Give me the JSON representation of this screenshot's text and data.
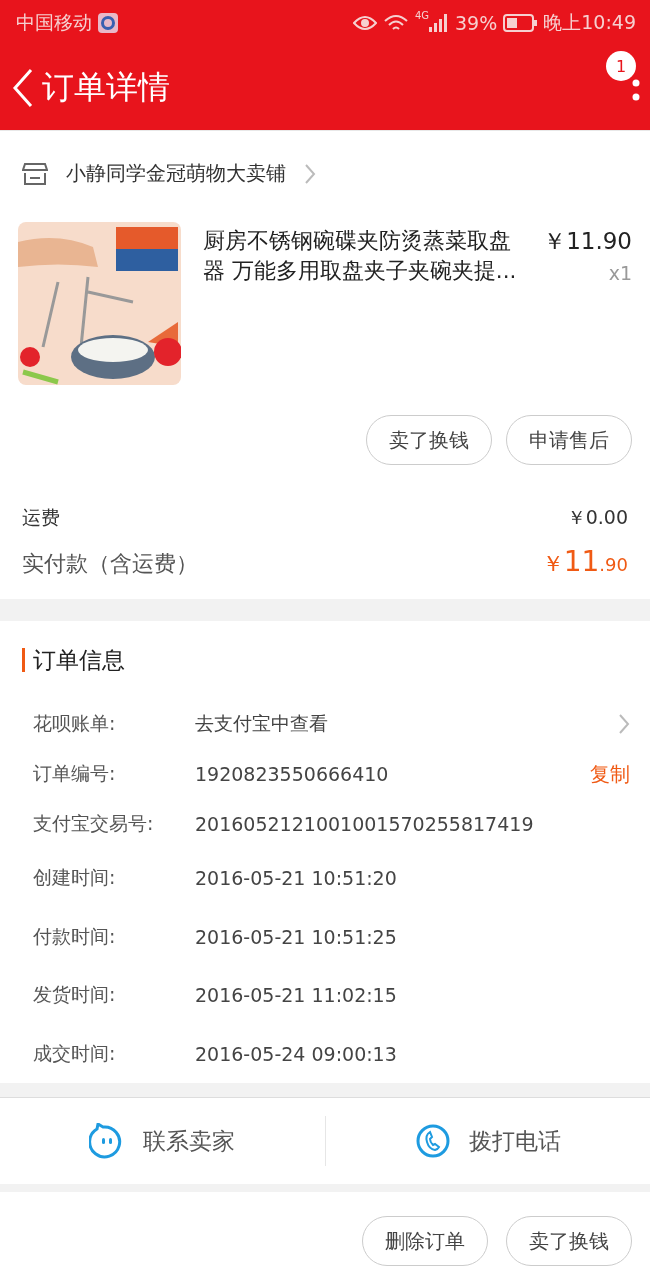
{
  "status_bar": {
    "carrier": "中国移动",
    "network": "4G",
    "battery": "39%",
    "time": "晚上10:49"
  },
  "header": {
    "title": "订单详情",
    "badge": "1"
  },
  "shop": {
    "name": "小静同学金冠萌物大卖铺"
  },
  "product": {
    "title": "厨房不锈钢碗碟夹防烫蒸菜取盘器 万能多用取盘夹子夹碗夹提...",
    "price": "￥11.90",
    "quantity": "x1"
  },
  "item_buttons": [
    "卖了换钱",
    "申请售后"
  ],
  "fees": [
    {
      "label": "运费",
      "value": "￥0.00"
    }
  ],
  "total": {
    "label": "实付款（含运费）",
    "symbol": "￥",
    "whole": "11",
    "fraction": ".90"
  },
  "order_info": {
    "title": "订单信息",
    "rows": [
      {
        "kind": "link",
        "label": "花呗账单:",
        "value": "去支付宝中查看"
      },
      {
        "kind": "copy",
        "label": "订单编号:",
        "value": "1920823550666410",
        "action": "复制"
      },
      {
        "kind": "plain",
        "label": "支付宝交易号:",
        "value": "2016052121001001570255817419"
      },
      {
        "kind": "plain",
        "label": "创建时间:",
        "value": "2016-05-21 10:51:20"
      },
      {
        "kind": "plain",
        "label": "付款时间:",
        "value": "2016-05-21 10:51:25"
      },
      {
        "kind": "plain",
        "label": "发货时间:",
        "value": "2016-05-21 11:02:15"
      },
      {
        "kind": "plain",
        "label": "成交时间:",
        "value": "2016-05-24 09:00:13"
      }
    ]
  },
  "contact": [
    {
      "kind": "chat",
      "label": "联系卖家"
    },
    {
      "kind": "phone",
      "label": "拨打电话"
    }
  ],
  "bottom_buttons": [
    "删除订单",
    "卖了换钱"
  ]
}
